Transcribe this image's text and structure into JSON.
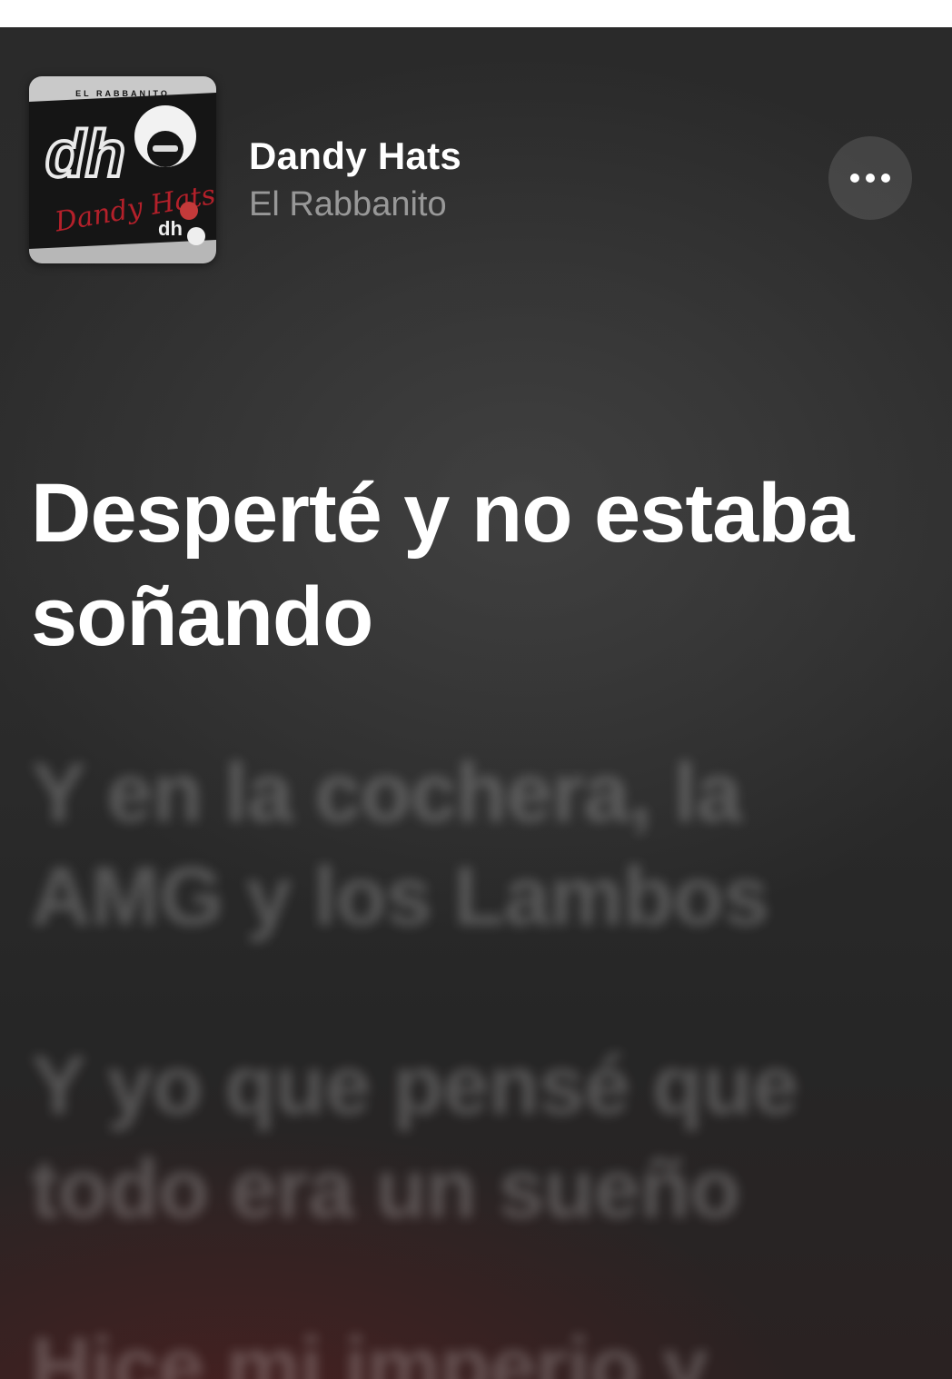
{
  "now_playing": {
    "title": "Dandy Hats",
    "artist": "El Rabbanito",
    "more_icon": "ellipsis-icon",
    "artwork": {
      "header_text": "EL RABBANITO",
      "logo_text": "dh",
      "script_text": "Dandy Hats",
      "small_logo": "dh"
    }
  },
  "lyrics": {
    "current": "Desperté y no estaba soñando",
    "upcoming": [
      "Y en la cochera, la AMG y los Lambos",
      "Y yo que pensé que todo era un sueño",
      "Hice mi imperio y"
    ]
  },
  "colors": {
    "background": "#2b2b2b",
    "current_line": "#ffffff",
    "accent_red": "#b3202a"
  }
}
